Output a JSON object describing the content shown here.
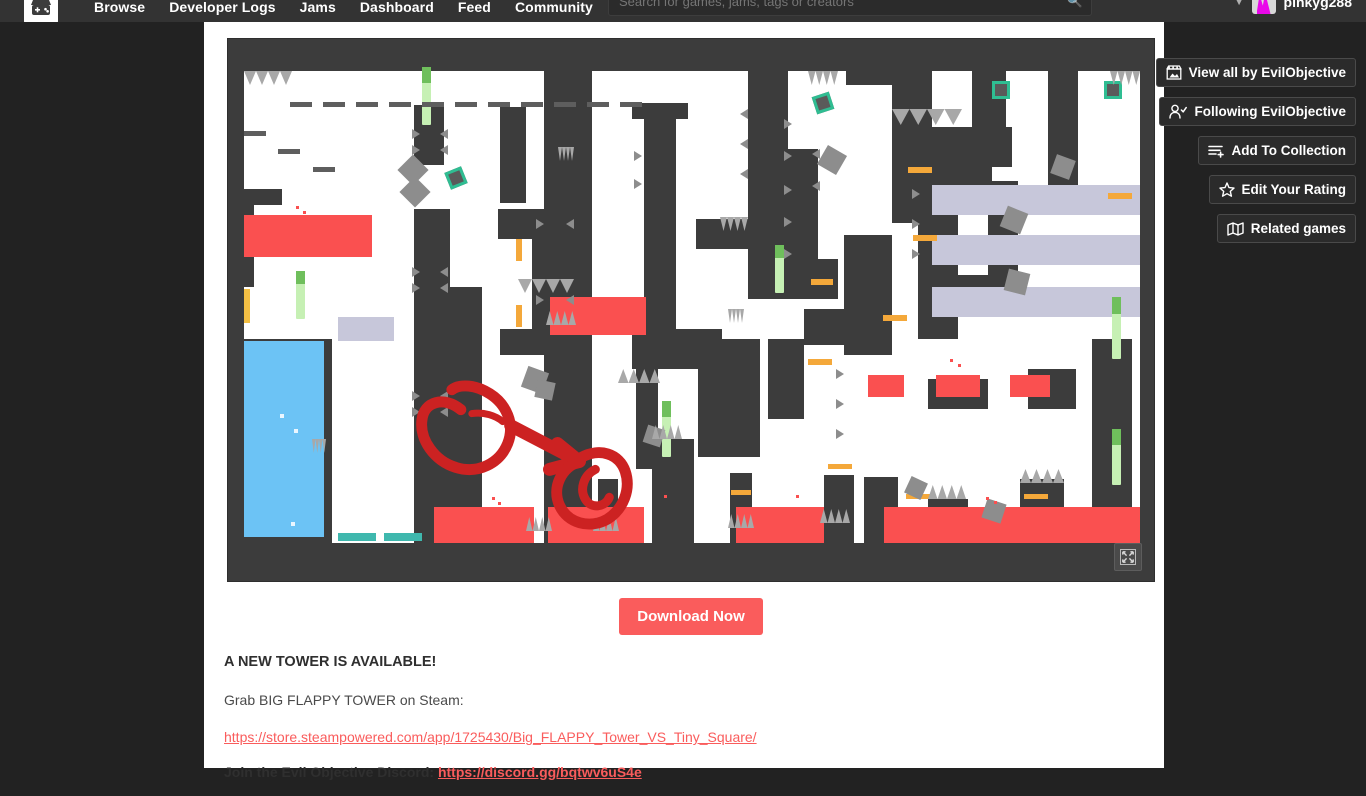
{
  "nav": {
    "logo_icon": "itch-io-logo-icon",
    "links": [
      {
        "label": "Browse"
      },
      {
        "label": "Developer Logs"
      },
      {
        "label": "Jams"
      },
      {
        "label": "Dashboard"
      },
      {
        "label": "Feed"
      },
      {
        "label": "Community"
      }
    ],
    "search": {
      "placeholder": "Search for games, jams, tags or creators",
      "value": "",
      "icon": "search-icon"
    },
    "user": {
      "name": "pinkyg288",
      "avatar_icon": "user-avatar",
      "caret_icon": "chevron-down-icon",
      "avatar_color": "#e908e9"
    }
  },
  "screenshot": {
    "alt": "Big FLAPPY Tower VS Tiny Square gameplay screenshot",
    "fullscreen_icon": "fullscreen-expand-icon",
    "palette": {
      "wall": "#3c3c3c",
      "open": "#ffffff",
      "hazard": "#fa5050",
      "water": "#6cc3f5",
      "band": "#c7c7da",
      "pad": "#3fb8ae",
      "ledge": "#f4a83a",
      "pill": "#c6f0b4",
      "spike": "#a8a8a8",
      "crate_border": "#2fbd92",
      "annotation": "#cc2222"
    },
    "annotation": "hand-drawn red circle with arrow pointing to second circled area"
  },
  "download": {
    "label": "Download Now",
    "color": "#fa5c5c"
  },
  "description": {
    "heading": "A NEW TOWER IS AVAILABLE!",
    "line1": "Grab BIG FLAPPY TOWER on Steam:",
    "steam_link": "https://store.steampowered.com/app/1725430/Big_FLAPPY_Tower_VS_Tiny_Square/",
    "discord_label": "Join the Evil Objective Discord:",
    "discord_link": "https://discord.gg/bqtwv6uS4e"
  },
  "sidebar": {
    "buttons": [
      {
        "label": "View all by EvilObjective",
        "icon": "storefront-icon"
      },
      {
        "label": "Following EvilObjective",
        "icon": "user-check-icon"
      },
      {
        "label": "Add To Collection",
        "icon": "list-add-icon"
      },
      {
        "label": "Edit Your Rating",
        "icon": "star-icon"
      },
      {
        "label": "Related games",
        "icon": "map-icon"
      }
    ]
  }
}
